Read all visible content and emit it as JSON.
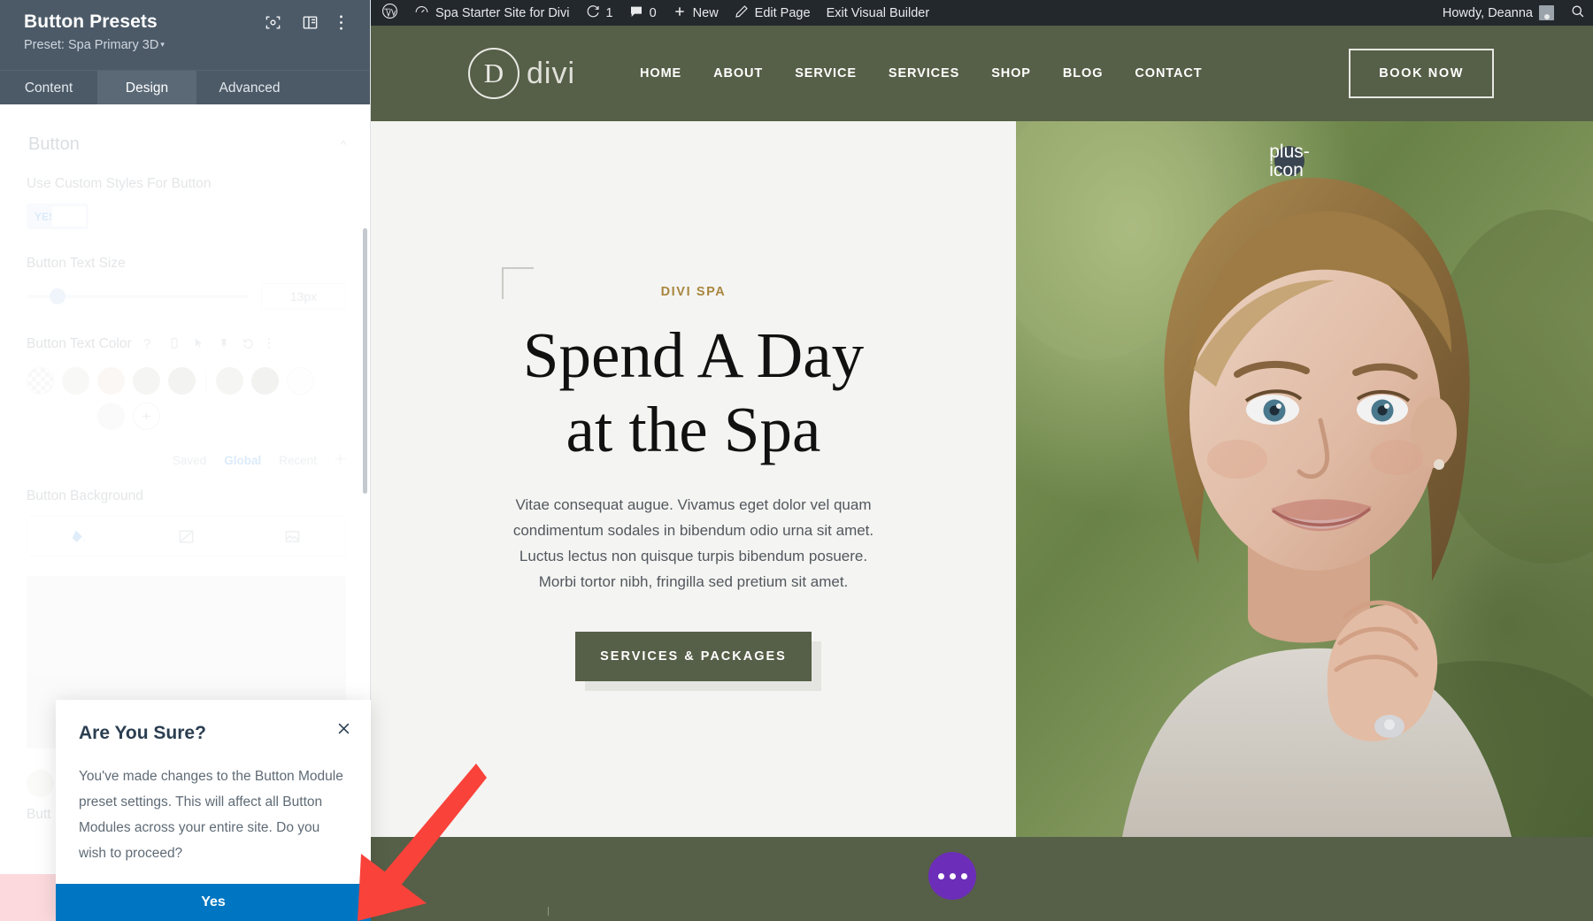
{
  "panel": {
    "title": "Button Presets",
    "subtitle": "Preset: Spa Primary 3D",
    "caret": "▾",
    "icons": [
      "focus-target-icon",
      "layout-columns-icon",
      "more-vertical-icon"
    ],
    "tabs": [
      {
        "label": "Content",
        "active": false
      },
      {
        "label": "Design",
        "active": true
      },
      {
        "label": "Advanced",
        "active": false
      }
    ],
    "settings": {
      "section_title": "Button",
      "toggle_label": "Use Custom Styles For Button",
      "toggle_value": "YES",
      "text_size_label": "Button Text Size",
      "text_size_value": "13px",
      "text_color_label": "Button Text Color",
      "help_icon": "?",
      "palette_tabs": [
        "Saved",
        "Global",
        "Recent"
      ],
      "palette_active": "Global",
      "background_label": "Button Background",
      "partial_label": "Butt"
    }
  },
  "modal": {
    "title": "Are You Sure?",
    "body": "You've made changes to the Button Module preset settings. This will affect all Button Modules across your entire site. Do you wish to proceed?",
    "confirm_label": "Yes",
    "close_icon": "close-icon"
  },
  "adminbar": {
    "wp_logo": "wordpress-logo-icon",
    "site_name": "Spa Starter Site for Divi",
    "updates_icon": "updates-icon",
    "updates_count": "1",
    "comments_icon": "comment-icon",
    "comments_count": "0",
    "new_label": "New",
    "new_icon": "plus-icon",
    "edit_label": "Edit Page",
    "edit_icon": "pencil-icon",
    "exit_label": "Exit Visual Builder",
    "greeting": "Howdy, Deanna",
    "search_icon": "search-icon"
  },
  "site": {
    "logo_letter": "D",
    "logo_text": "divi",
    "nav": [
      "HOME",
      "ABOUT",
      "SERVICE",
      "SERVICES",
      "SHOP",
      "BLOG",
      "CONTACT"
    ],
    "book_label": "BOOK NOW",
    "hero": {
      "eyebrow": "DIVI SPA",
      "heading_line1": "Spend A Day",
      "heading_line2": "at the Spa",
      "paragraph": "Vitae consequat augue. Vivamus eget dolor vel quam condimentum sodales in bibendum odio urna sit amet. Luctus lectus non quisque turpis bibendum posuere. Morbi tortor nibh, fringilla sed pretium sit amet.",
      "cta_label": "SERVICES & PACKAGES"
    },
    "add_section_icon": "plus-icon",
    "fab_icon": "more-horizontal-icon"
  },
  "annotation": {
    "arrow": "red-arrow-pointing-to-yes-button"
  },
  "colors": {
    "panel_header": "#4c5a68",
    "accent_blue": "#0075c1",
    "site_green": "#565f47",
    "gold": "#a9863f",
    "fab_purple": "#6c2eb9",
    "arrow_red": "#f9423a",
    "adminbar": "#23282d"
  }
}
